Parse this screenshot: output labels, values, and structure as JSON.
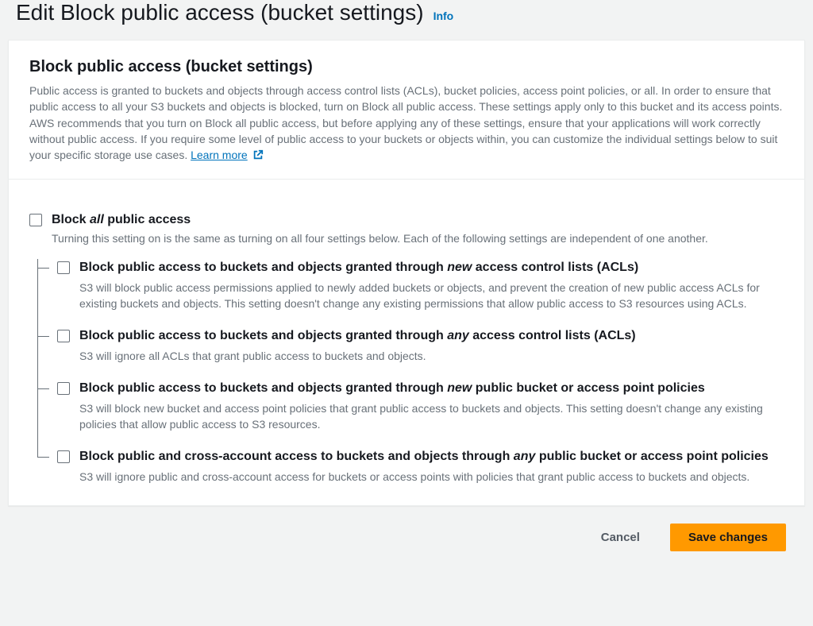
{
  "header": {
    "title": "Edit Block public access (bucket settings)",
    "info_label": "Info"
  },
  "panel": {
    "title": "Block public access (bucket settings)",
    "description": "Public access is granted to buckets and objects through access control lists (ACLs), bucket policies, access point policies, or all. In order to ensure that public access to all your S3 buckets and objects is blocked, turn on Block all public access. These settings apply only to this bucket and its access points. AWS recommends that you turn on Block all public access, but before applying any of these settings, ensure that your applications will work correctly without public access. If you require some level of public access to your buckets or objects within, you can customize the individual settings below to suit your specific storage use cases. ",
    "learn_more": "Learn more"
  },
  "master": {
    "label_pre": "Block ",
    "label_em": "all",
    "label_post": " public access",
    "description": "Turning this setting on is the same as turning on all four settings below. Each of the following settings are independent of one another."
  },
  "children": [
    {
      "label_pre": "Block public access to buckets and objects granted through ",
      "label_em": "new",
      "label_post": " access control lists (ACLs)",
      "description": "S3 will block public access permissions applied to newly added buckets or objects, and prevent the creation of new public access ACLs for existing buckets and objects. This setting doesn't change any existing permissions that allow public access to S3 resources using ACLs."
    },
    {
      "label_pre": "Block public access to buckets and objects granted through ",
      "label_em": "any",
      "label_post": " access control lists (ACLs)",
      "description": "S3 will ignore all ACLs that grant public access to buckets and objects."
    },
    {
      "label_pre": "Block public access to buckets and objects granted through ",
      "label_em": "new",
      "label_post": " public bucket or access point policies",
      "description": "S3 will block new bucket and access point policies that grant public access to buckets and objects. This setting doesn't change any existing policies that allow public access to S3 resources."
    },
    {
      "label_pre": "Block public and cross-account access to buckets and objects through ",
      "label_em": "any",
      "label_post": " public bucket or access point policies",
      "description": "S3 will ignore public and cross-account access for buckets or access points with policies that grant public access to buckets and objects."
    }
  ],
  "footer": {
    "cancel": "Cancel",
    "save": "Save changes"
  }
}
